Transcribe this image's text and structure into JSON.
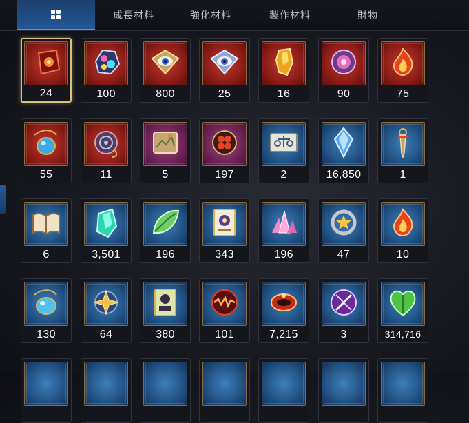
{
  "tabs": [
    {
      "id": "all",
      "label": "",
      "icon": "grid-icon"
    },
    {
      "id": "growth",
      "label": "成長材料"
    },
    {
      "id": "enhance",
      "label": "強化材料"
    },
    {
      "id": "craft",
      "label": "製作材料"
    },
    {
      "id": "treasure",
      "label": "財物"
    }
  ],
  "active_tab": "all",
  "items": [
    {
      "icon": "red-rune-stone-icon",
      "quantity": "24",
      "rarity": "red",
      "selected": true
    },
    {
      "icon": "iridescent-ore-icon",
      "quantity": "100",
      "rarity": "red"
    },
    {
      "icon": "golden-eye-emblem-icon",
      "quantity": "800",
      "rarity": "red"
    },
    {
      "icon": "silver-eye-emblem-icon",
      "quantity": "25",
      "rarity": "red"
    },
    {
      "icon": "amber-crystal-icon",
      "quantity": "16",
      "rarity": "red"
    },
    {
      "icon": "pink-orb-icon",
      "quantity": "90",
      "rarity": "red"
    },
    {
      "icon": "flame-charm-icon",
      "quantity": "75",
      "rarity": "red"
    },
    {
      "icon": "blue-pendant-icon",
      "quantity": "55",
      "rarity": "red"
    },
    {
      "icon": "spiral-pendant-icon",
      "quantity": "11",
      "rarity": "red"
    },
    {
      "icon": "map-scroll-icon",
      "quantity": "5",
      "rarity": "purple"
    },
    {
      "icon": "red-clover-ring-icon",
      "quantity": "197",
      "rarity": "purple"
    },
    {
      "icon": "scale-ticket-icon",
      "quantity": "2",
      "rarity": "blue"
    },
    {
      "icon": "blue-diamond-icon",
      "quantity": "16,850",
      "rarity": "blue"
    },
    {
      "icon": "dagger-charm-icon",
      "quantity": "1",
      "rarity": "blue"
    },
    {
      "icon": "open-book-icon",
      "quantity": "6",
      "rarity": "blue"
    },
    {
      "icon": "teal-crystal-icon",
      "quantity": "3,501",
      "rarity": "blue"
    },
    {
      "icon": "green-leaf-icon",
      "quantity": "196",
      "rarity": "blue"
    },
    {
      "icon": "medal-card-icon",
      "quantity": "343",
      "rarity": "blue"
    },
    {
      "icon": "pink-crystal-cluster-icon",
      "quantity": "196",
      "rarity": "blue"
    },
    {
      "icon": "star-ring-icon",
      "quantity": "47",
      "rarity": "blue"
    },
    {
      "icon": "flame-charm-icon",
      "quantity": "10",
      "rarity": "blue"
    },
    {
      "icon": "water-pendant-icon",
      "quantity": "130",
      "rarity": "blue"
    },
    {
      "icon": "gold-star-ring-icon",
      "quantity": "64",
      "rarity": "blue"
    },
    {
      "icon": "character-card-icon",
      "quantity": "380",
      "rarity": "blue"
    },
    {
      "icon": "red-vortex-orb-icon",
      "quantity": "101",
      "rarity": "blue"
    },
    {
      "icon": "red-bracelet-icon",
      "quantity": "7,215",
      "rarity": "blue"
    },
    {
      "icon": "purple-sword-seal-icon",
      "quantity": "3",
      "rarity": "blue"
    },
    {
      "icon": "green-heart-icon",
      "quantity": "314,716",
      "rarity": "blue"
    }
  ],
  "partial_row_rarity": [
    "blue",
    "blue",
    "blue",
    "blue",
    "blue",
    "blue",
    "blue"
  ]
}
